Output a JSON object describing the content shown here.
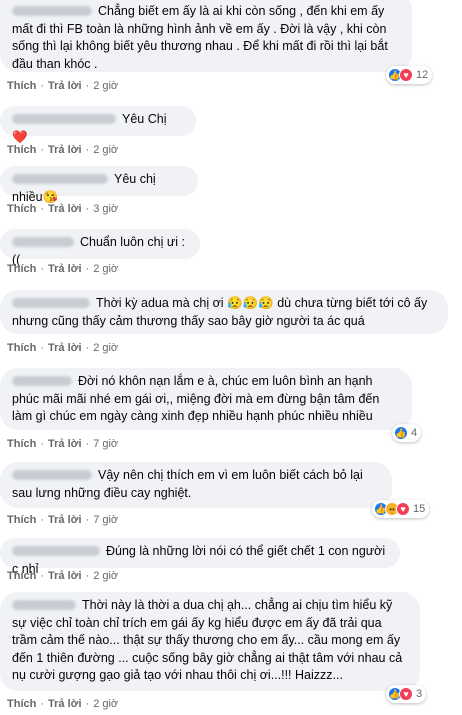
{
  "actions": {
    "like": "Thích",
    "reply": "Trả lời"
  },
  "comments": [
    {
      "text": "Chẳng biết em ấy là ai khi còn sống , đến khi em ấy mất đi thì FB toàn là những hình ảnh về em ấy . Đời là vậy , khi còn sống thì lại không biết yêu thương nhau . Để khi mất đi rồi thì lại bắt đầu than khóc .",
      "time": "2 giờ",
      "reactions": "12"
    },
    {
      "text": "Yêu Chị ❤️",
      "time": "2 giờ"
    },
    {
      "text": "Yêu chị nhiều😘",
      "time": "3 giờ"
    },
    {
      "text": "Chuẩn luôn chị ưi :((",
      "time": "2 giờ"
    },
    {
      "text": "Thời kỳ adua mà chị ơi 😥😥😥 dù chưa từng biết tới cô ấy nhưng cũng thấy cảm thương thấy sao bây giờ người ta ác quá",
      "time": "2 giờ"
    },
    {
      "text": "Đời nó khôn nạn lắm e à, chúc em luôn bình an hạnh phúc mãi mãi nhé em gái ơi,, miệng đời mà em đừng bận tâm đến làm gì chúc em ngày càng xinh đẹp nhiều hạnh phúc nhiều nhiều",
      "time": "7 giờ",
      "reactions": "4"
    },
    {
      "text": "Vậy nên chị thích em vì em luôn biết cách bỏ lại sau lưng những điều cay nghiệt.",
      "time": "7 giờ",
      "reactions": "15"
    },
    {
      "text": "Đúng là những lời nói có thể giết chết 1 con người c nhỉ",
      "time": "2 giờ"
    },
    {
      "text": "Thời này là thời a dua chị ạh... chẳng ai chịu tìm hiểu kỹ sự việc chỉ toàn chỉ trích em gái ấy kg hiểu được em ấy đã trải qua trầm cảm thế nào... thật sự thấy thương cho em ấy... cầu mong em ấy đến 1 thiên đường ... cuộc sống bây giờ chẳng ai thật tâm với nhau cả nụ cười gượng gạo giả tạo với nhau thôi chị ơi...!!! Haizzz...",
      "time": "2 giờ",
      "reactions": "3"
    }
  ],
  "colors": {
    "bubble": "#f0f2f5",
    "meta": "#65676b",
    "like": "#1877f2",
    "love": "#f33e58",
    "sad": "#f7b125"
  },
  "icons": [
    "like-icon",
    "love-icon",
    "sad-icon"
  ]
}
